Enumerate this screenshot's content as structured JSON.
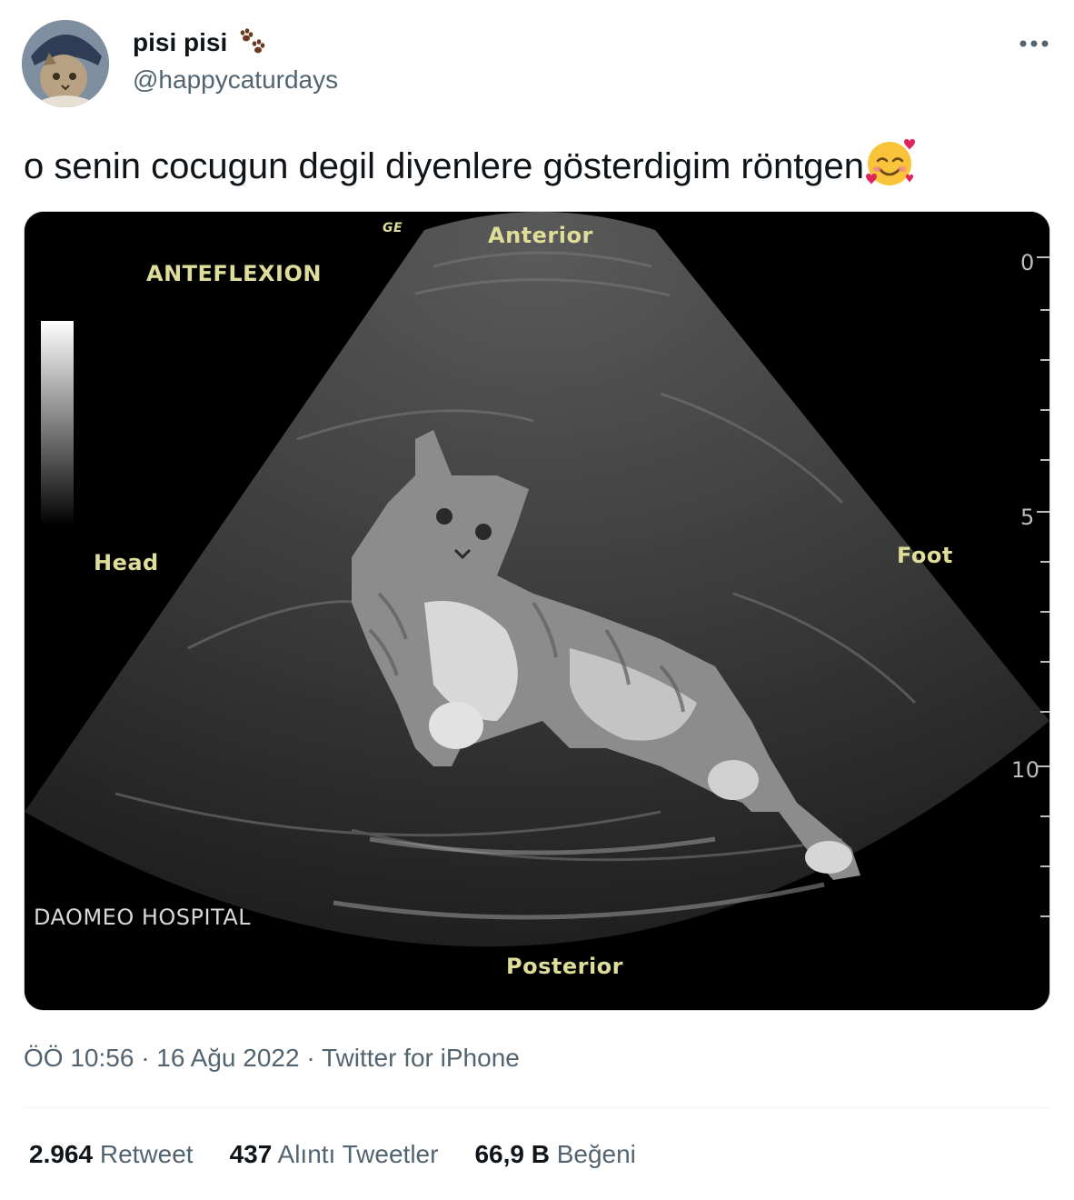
{
  "tweet": {
    "display_name": "pisi pisi",
    "handle": "@happycaturdays",
    "text": "o senin cocugun degil diyenlere gösterdigim röntgen",
    "emoji_icon": "smiling-face-with-hearts-icon",
    "name_emoji_icon": "paw-prints-icon",
    "more_icon": "more-options-icon"
  },
  "media": {
    "labels": {
      "ge": "GE",
      "anterior": "Anterior",
      "anteflexion": "ANTEFLEXION",
      "head": "Head",
      "foot": "Foot",
      "hospital": "DAOMEO HOSPITAL",
      "posterior": "Posterior",
      "scale_0": "0",
      "scale_5": "5",
      "scale_10": "10"
    }
  },
  "meta": {
    "time": "ÖÖ 10:56",
    "date": "16 Ağu 2022",
    "source": "Twitter for iPhone",
    "separator": "·"
  },
  "stats": {
    "retweets_count": "2.964",
    "retweets_label": "Retweet",
    "quotes_count": "437",
    "quotes_label": "Alıntı Tweetler",
    "likes_count": "66,9 B",
    "likes_label": "Beğeni"
  },
  "colors": {
    "text_primary": "#0f1419",
    "text_secondary": "#536471",
    "ultrasound_label": "#dede9a"
  }
}
